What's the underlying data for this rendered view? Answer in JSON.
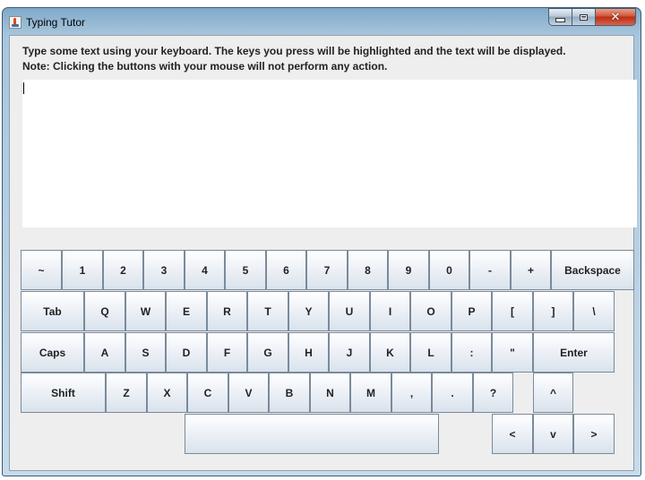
{
  "window": {
    "title": "Typing Tutor",
    "controls": {
      "minimize": "minimize",
      "maximize": "maximize",
      "close": "✕"
    }
  },
  "instructions": {
    "line1": "Type some text using your keyboard.  The keys you press will be highlighted and the text will be displayed.",
    "line2": "Note: Clicking the buttons with your mouse will not perform any action."
  },
  "text_area": {
    "value": ""
  },
  "keyboard": {
    "row1": [
      "~",
      "1",
      "2",
      "3",
      "4",
      "5",
      "6",
      "7",
      "8",
      "9",
      "0",
      "-",
      "+",
      "Backspace"
    ],
    "row2": [
      "Tab",
      "Q",
      "W",
      "E",
      "R",
      "T",
      "Y",
      "U",
      "I",
      "O",
      "P",
      "[",
      "]",
      "\\"
    ],
    "row3": [
      "Caps",
      "A",
      "S",
      "D",
      "F",
      "G",
      "H",
      "J",
      "K",
      "L",
      ":",
      "\"",
      "Enter"
    ],
    "row4": [
      "Shift",
      "Z",
      "X",
      "C",
      "V",
      "B",
      "N",
      "M",
      ",",
      ".",
      "?",
      "^"
    ],
    "row5": [
      "",
      "<",
      "v",
      ">"
    ]
  },
  "icons": {
    "app": "java-cup-icon"
  }
}
